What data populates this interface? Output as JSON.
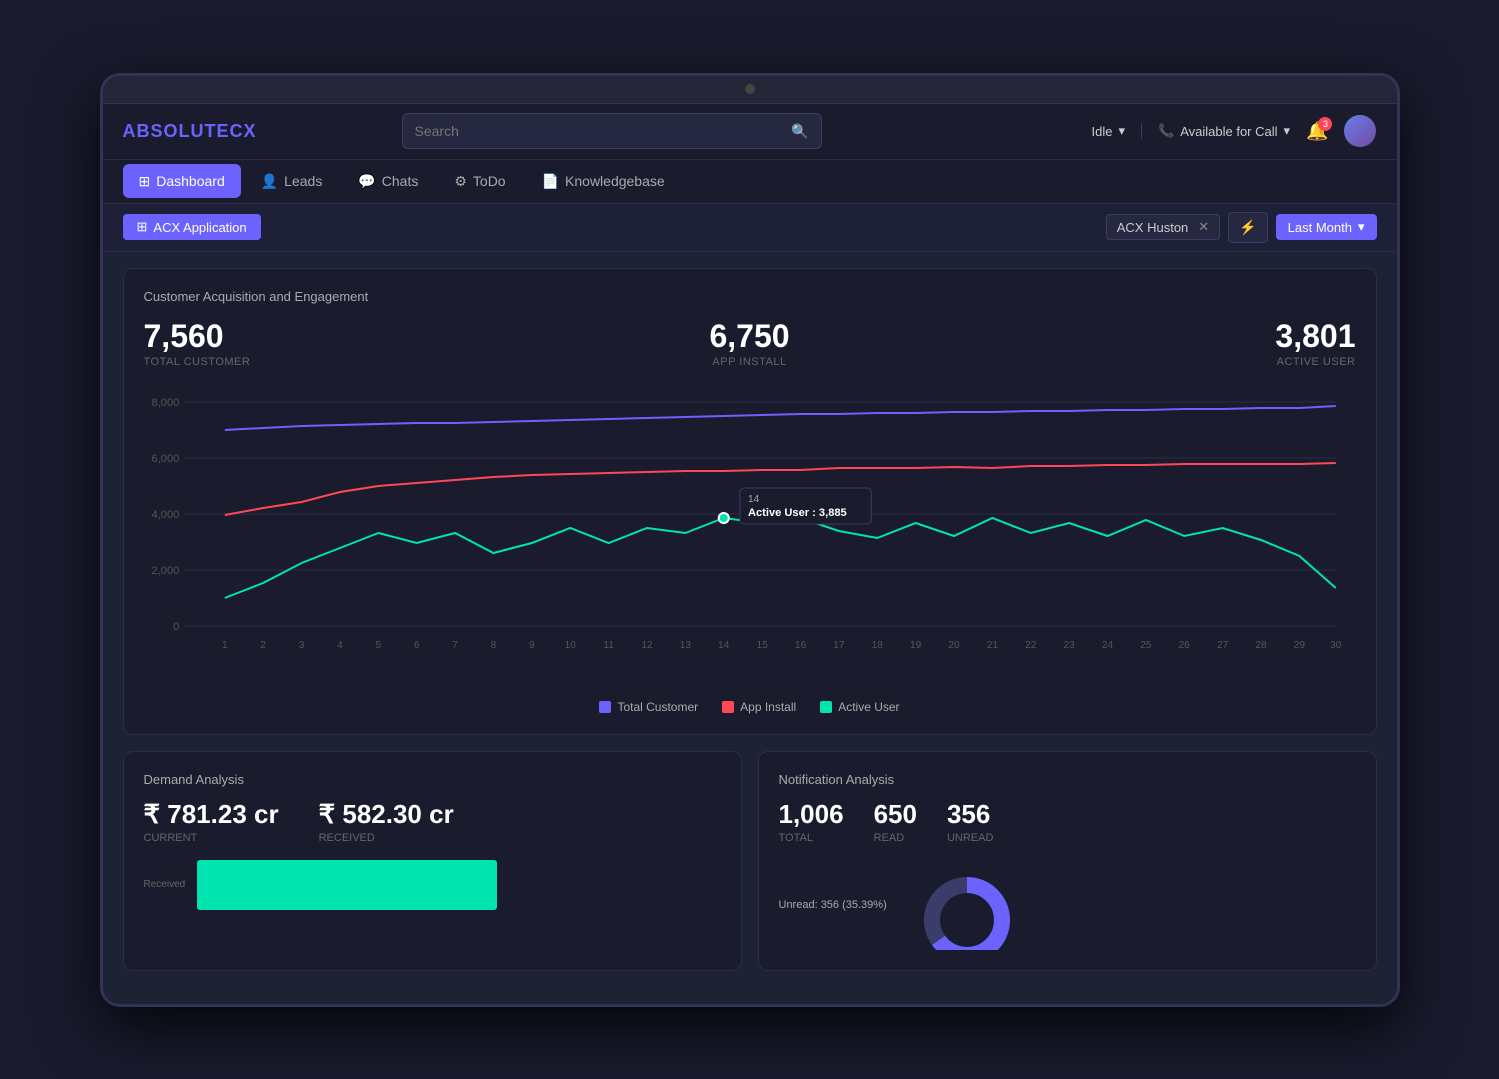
{
  "device": {
    "title": "AbsoluteCX Dashboard"
  },
  "header": {
    "logo_text": "ABSOLUTE",
    "logo_accent": "CX",
    "search_placeholder": "Search",
    "idle_label": "Idle",
    "available_label": "Available for Call",
    "bell_count": "3",
    "nav_items": [
      {
        "label": "Dashboard",
        "icon": "⊞",
        "active": true
      },
      {
        "label": "Leads",
        "icon": "👤",
        "active": false
      },
      {
        "label": "Chats",
        "icon": "💬",
        "active": false
      },
      {
        "label": "ToDo",
        "icon": "⚙",
        "active": false
      },
      {
        "label": "Knowledgebase",
        "icon": "📄",
        "active": false
      }
    ]
  },
  "breadcrumb": {
    "app_label": "ACX Application",
    "filter_tag": "ACX Huston",
    "date_label": "Last Month"
  },
  "chart_section": {
    "title": "Customer Acquisition and Engagement",
    "total_customer_value": "7,560",
    "total_customer_label": "Total Customer",
    "app_install_value": "6,750",
    "app_install_label": "App Install",
    "active_user_value": "3,801",
    "active_user_label": "Active User",
    "tooltip_day": "14",
    "tooltip_label": "Active User : 3,885",
    "y_labels": [
      "8,000",
      "6,000",
      "4,000",
      "2,000",
      "0"
    ],
    "x_labels": [
      "1",
      "2",
      "3",
      "4",
      "5",
      "6",
      "7",
      "8",
      "9",
      "10",
      "11",
      "12",
      "13",
      "14",
      "15",
      "16",
      "17",
      "18",
      "19",
      "20",
      "21",
      "22",
      "23",
      "24",
      "25",
      "26",
      "27",
      "28",
      "29",
      "30"
    ],
    "legend": [
      {
        "label": "Total Customer",
        "color": "#6c63ff"
      },
      {
        "label": "App Install",
        "color": "#ff4757"
      },
      {
        "label": "Active User",
        "color": "#00e5b0"
      }
    ]
  },
  "demand_analysis": {
    "title": "Demand Analysis",
    "current_value": "₹ 781.23 cr",
    "current_label": "Current",
    "received_value": "₹ 582.30 cr",
    "received_label": "Received",
    "bar_label": "Received"
  },
  "notification_analysis": {
    "title": "Notification Analysis",
    "total_value": "1,006",
    "total_label": "Total",
    "read_value": "650",
    "read_label": "Read",
    "unread_value": "356",
    "unread_label": "Unread",
    "unread_pct_label": "Unread: 356 (35.39%)"
  }
}
